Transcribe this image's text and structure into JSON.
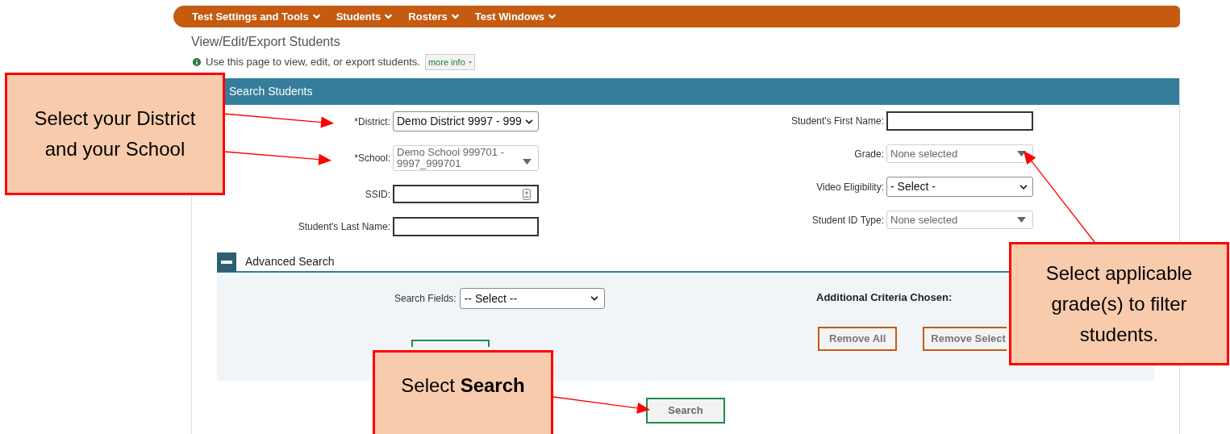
{
  "nav": {
    "items": [
      {
        "label": "Test Settings and Tools"
      },
      {
        "label": "Students"
      },
      {
        "label": "Rosters"
      },
      {
        "label": "Test Windows"
      }
    ]
  },
  "page": {
    "title": "View/Edit/Export Students",
    "info": "Use this page to view, edit, or export students.",
    "more_info": "more info"
  },
  "search_panel": {
    "title": "Search Students",
    "left_fields": [
      {
        "kind": "select",
        "label": "*District:",
        "value": "Demo District 9997 - 999"
      },
      {
        "kind": "multiselect",
        "label": "*School:",
        "value": "Demo School 999701 - 9997_999701"
      },
      {
        "kind": "input_icon",
        "label": "SSID:"
      },
      {
        "kind": "input",
        "label": "Student's Last Name:"
      }
    ],
    "right_fields": [
      {
        "kind": "input",
        "label": "Student's First Name:"
      },
      {
        "kind": "multiselect",
        "label": "Grade:",
        "value": "None selected"
      },
      {
        "kind": "select",
        "label": "Video Eligibility:",
        "value": "- Select -"
      },
      {
        "kind": "multiselect",
        "label": "Student ID Type:",
        "value": "None selected"
      }
    ],
    "advanced_search": {
      "title": "Advanced Search",
      "expanded": true,
      "search_fields": {
        "label": "Search Fields:",
        "value": "-- Select --"
      },
      "criteria_title": "Additional Criteria Chosen:",
      "buttons": [
        "Remove All",
        "Remove Select"
      ]
    },
    "search_button": "Search"
  },
  "callouts": [
    {
      "text": "Select your District and your School"
    },
    {
      "text": "Select applicable grade(s) to filter students."
    },
    {
      "text": "Select **Search**"
    }
  ]
}
